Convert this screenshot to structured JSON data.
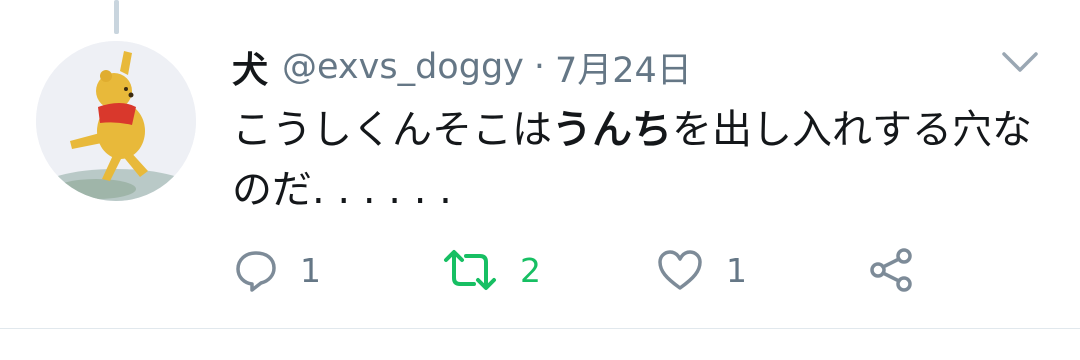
{
  "tweet": {
    "display_name": "犬",
    "handle": "@exvs_doggy",
    "separator": "·",
    "date": "7月24日",
    "text_before": "こうしくんそこは",
    "text_bold": "うんち",
    "text_after": "を出し入れする穴なのだ. . . . . ."
  },
  "actions": {
    "reply_count": "1",
    "retweet_count": "2",
    "like_count": "1"
  },
  "icons": {
    "reply": "reply-bubble-icon",
    "retweet": "retweet-arrows-icon",
    "like": "heart-icon",
    "share": "share-nodes-icon",
    "menu": "chevron-down-icon"
  },
  "colors": {
    "text": "#14171a",
    "secondary": "#657786",
    "retweet_active": "#17bf63",
    "icon_gray": "#7d8b98"
  }
}
